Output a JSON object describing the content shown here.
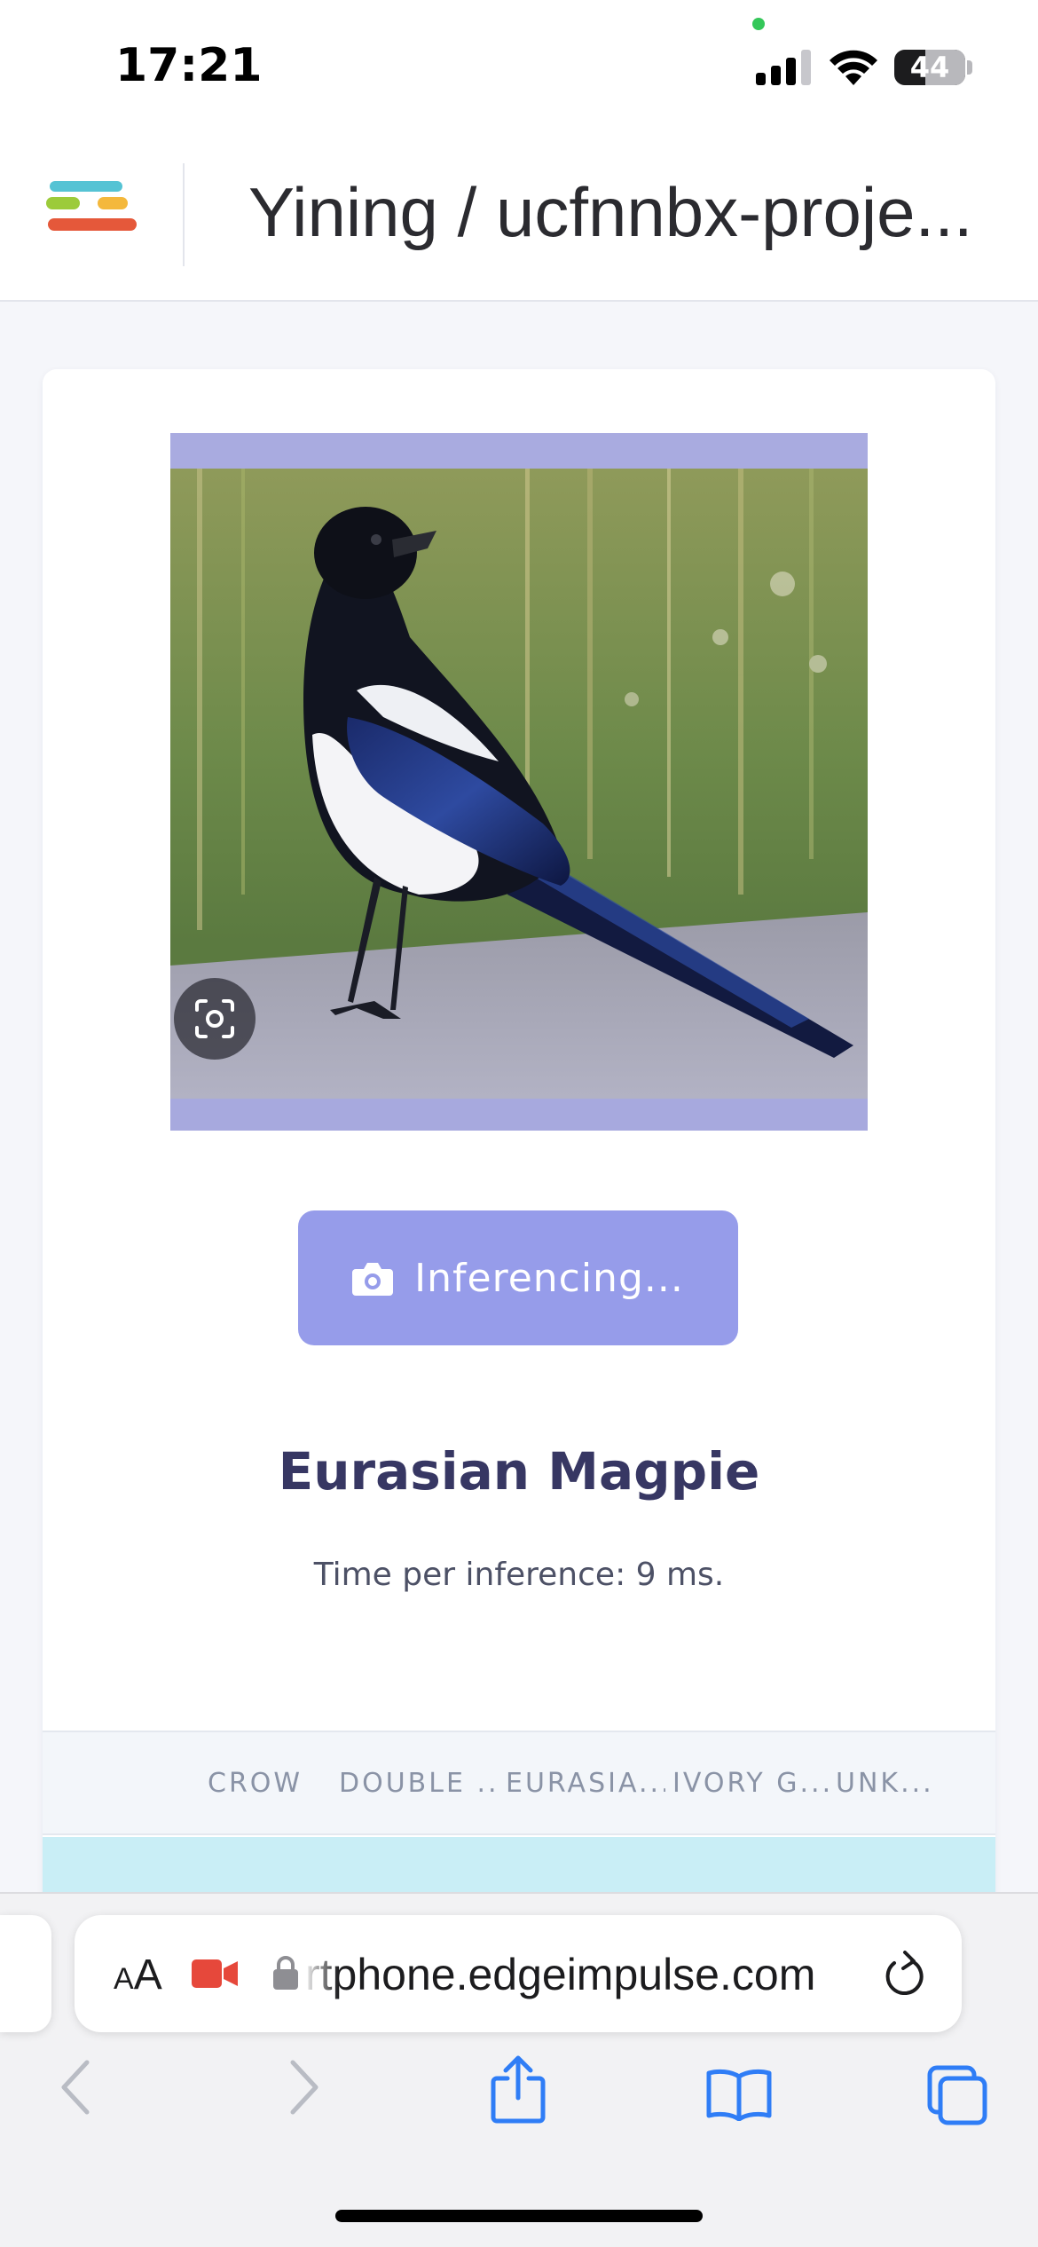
{
  "status_bar": {
    "time": "17:21",
    "battery_level": "44",
    "battery_fraction": 0.44,
    "icons": [
      "signal-icon",
      "wifi-icon",
      "battery-icon"
    ]
  },
  "header": {
    "logo_icon": "edge-impulse-logo",
    "project_title": "Yining / ucfnnbx-proje..."
  },
  "classifier": {
    "preview_icon": "scan-icon",
    "button_label": "Inferencing...",
    "button_icon": "camera-icon",
    "button_color": "#969cea",
    "prediction": "Eurasian Magpie",
    "time_per_inference": "Time per inference: 9 ms.",
    "class_columns": [
      "CROW",
      "DOUBLE ...",
      "EURASIA...",
      "IVORY G...",
      "UNK..."
    ],
    "result_row_color": "#c9eef6"
  },
  "browser": {
    "reader_label_small": "A",
    "reader_label_large": "A",
    "url": "rtphone.edgeimpulse.com",
    "icons": [
      "video-icon",
      "lock-icon",
      "reload-icon"
    ],
    "toolbar_icons": [
      "back-icon",
      "forward-icon",
      "share-icon",
      "bookmarks-icon",
      "tabs-icon"
    ]
  }
}
